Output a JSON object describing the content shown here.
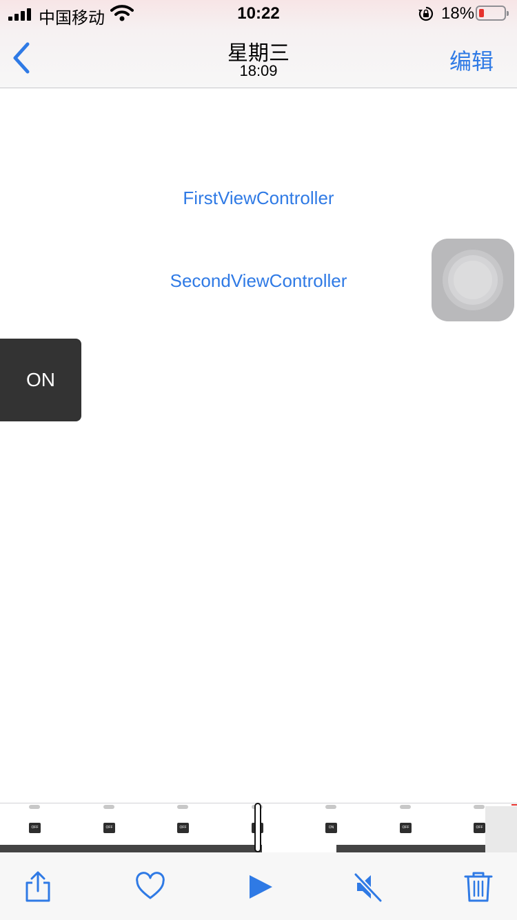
{
  "status_bar": {
    "carrier": "中国移动",
    "time": "10:22",
    "battery_percent": "18%",
    "battery_color": "#e5322d"
  },
  "nav": {
    "title": "星期三",
    "subtitle": "18:09",
    "edit_label": "编辑",
    "back_icon": "chevron-left-icon",
    "accent_color": "#2f7ae5"
  },
  "content": {
    "first_link": "FirstViewController",
    "second_link": "SecondViewController",
    "toggle_label": "ON"
  },
  "scrubber": {
    "frame_labels": [
      "OFF",
      "OFF",
      "OFF",
      "ON",
      "ON",
      "OFF",
      "OFF"
    ]
  },
  "toolbar": {
    "icons": [
      "share-icon",
      "heart-icon",
      "play-icon",
      "speaker-muted-icon",
      "trash-icon"
    ]
  }
}
